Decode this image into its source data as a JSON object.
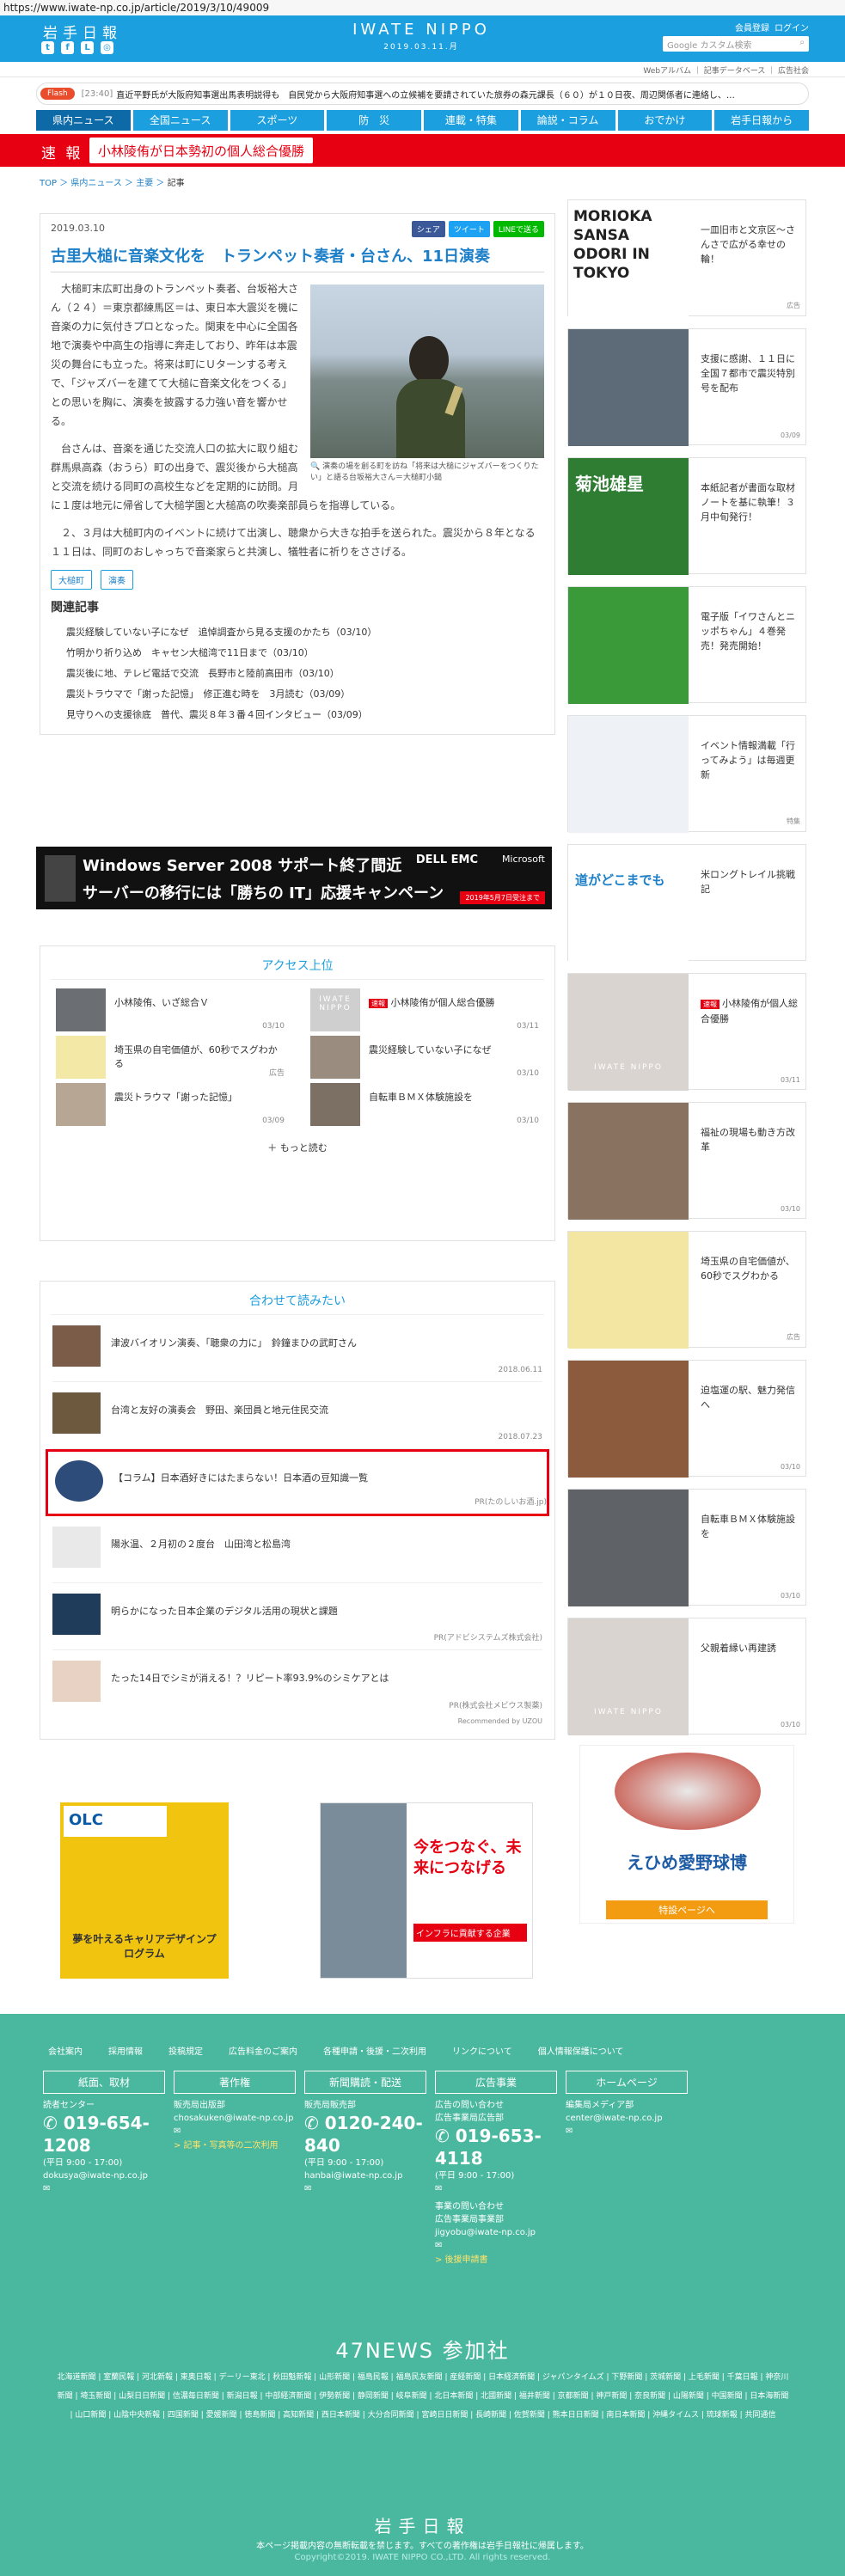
{
  "url": "https://www.iwate-np.co.jp/article/2019/3/10/49009",
  "header": {
    "logo": "岩手日報",
    "brand": "IWATE NIPPO",
    "date": "2019.03.11.月",
    "links": [
      "会員登録",
      "ログイン"
    ],
    "search_placeholder": "Google カスタム検索",
    "sub_links": [
      "Webアルバム",
      "記事データベース",
      "広告社会"
    ]
  },
  "flash": {
    "tag": "Flash",
    "time": "[23:40]",
    "text": "直近平野氏が大阪府知事選出馬表明説得も　自民党から大阪府知事選への立候補を要請されていた旅券の森元課長（６０）が１０日夜、周辺関係者に連絡し、…"
  },
  "nav": [
    "県内ニュース",
    "全国ニュース",
    "スポーツ",
    "防　災",
    "連載・特集",
    "論説・コラム",
    "おでかけ",
    "岩手日報から"
  ],
  "breaking": {
    "label": "速 報",
    "text": "小林陵侑が日本勢初の個人総合優勝"
  },
  "breadcrumb": [
    "TOP",
    "県内ニュース",
    "主要",
    "記事"
  ],
  "article": {
    "date": "2019.03.10",
    "share": [
      "シェア",
      "ツイート",
      "LINEで送る"
    ],
    "title": "古里大槌に音楽文化を　トランペット奏者・台さん、11日演奏",
    "caption": "演奏の場を創る町を訪ね「将来は大槌にジャズバーをつくりたい」と語る台坂裕大さん＝大槌町小鎚",
    "p1": "大槌町末広町出身のトランペット奏者、台坂裕大さん（２４）＝東京都練馬区＝は、東日本大震災を機に音楽の力に気付きプロとなった。関東を中心に全国各地で演奏や中高生の指導に奔走しており、昨年は本震災の舞台にも立った。将来は町にＵターンする考えで、「ジャズバーを建てて大槌に音楽文化をつくる」との思いを胸に、演奏を披露する力強い音を響かせる。",
    "p2": "台さんは、音楽を通じた交流人口の拡大に取り組む群馬県高森（おうら）町の出身で、震災後から大槌高と交流を続ける同町の高校生などを定期的に訪問。月に１度は地元に帰省して大槌学園と大槌高の吹奏楽部員らを指導している。",
    "p3": "２、３月は大槌町内のイベントに続けて出演し、聴衆から大きな拍手を送られた。震災から８年となる１１日は、同町のおしゃっちで音楽家らと共演し、犠牲者に祈りをささげる。",
    "tags": [
      "大槌町",
      "演奏"
    ],
    "related_heading": "関連記事",
    "related": [
      "震災経験していない子になぜ　追悼調査から見る支援のかたち（03/10）",
      "竹明かり祈り込め　キャセン大槌湾で11日まで（03/10）",
      "震災後に地、テレビ電話で交流　長野市と陸前高田市（03/10）",
      "震災トラウマで「謝った記憶」　修正進む時を　3月読む（03/09）",
      "見守りへの支援徐底　普代、震災８年３番４回インタビュー（03/09）"
    ]
  },
  "ad_banner": {
    "line1": "Windows Server 2008 サポート終了間近",
    "line2": "サーバーの移行には「勝ちの IT」応援キャンペーン",
    "vendor": "DELL EMC",
    "partner": "Microsoft",
    "small": "2019年5月7日受注まで"
  },
  "access": {
    "heading": "アクセス上位",
    "items": [
      {
        "title": "小林陵侑、いざ総合Ｖ",
        "date": "03/10"
      },
      {
        "title": "小林陵侑が個人総合優勝",
        "date": "03/11",
        "badge": "速報"
      },
      {
        "title": "埼玉県の自宅価値が、60秒でスグわかる",
        "date": "広告"
      },
      {
        "title": "震災経験していない子になぜ",
        "date": "03/10"
      },
      {
        "title": "震災トラウマ「謝った記憶」",
        "date": "03/09"
      },
      {
        "title": "自転車ＢＭＸ体験施設を",
        "date": "03/10"
      }
    ],
    "more": "もっと読む"
  },
  "recommend": {
    "heading": "合わせて読みたい",
    "items": [
      {
        "title": "津波バイオリン演奏、「聴衆の力に」　鈴鐘まひの武町さん",
        "date": "2018.06.11"
      },
      {
        "title": "台湾と友好の演奏会　野田、楽団員と地元住民交流",
        "date": "2018.07.23"
      },
      {
        "title": "【コラム】日本酒好きにはたまらない！日本酒の豆知識一覧",
        "date": "PR(たのしいお酒.jp)"
      },
      {
        "title": "陽氷温、２月初の２度台　山田湾と松島湾",
        "date": ""
      },
      {
        "title": "明らかになった日本企業のデジタル活用の現状と課題",
        "date": "PR(アドビシステムズ株式会社)"
      },
      {
        "title": "たった14日でシミが消える！？リピート率93.9%のシミケアとは",
        "date": "PR(株式会社メビウス製薬)"
      }
    ],
    "powered": "Recommended by UZOU"
  },
  "side": [
    {
      "title": "一皿旧市と文京区〜さんさで広がる幸せの輪！",
      "date": "広告",
      "thumb": "MORIOKA SANSA ODORI IN TOKYO"
    },
    {
      "title": "支援に感謝、１１日に全国７都市で震災特別号を配布",
      "date": "03/09"
    },
    {
      "title": "本紙記者が書面な取材ノートを基に執筆！３月中旬発行！",
      "date": "",
      "thumb": "菊池雄星"
    },
    {
      "title": "電子版「イワさんとニッポちゃん」４巻発売！発売開始！",
      "date": ""
    },
    {
      "title": "イベント情報満載「行ってみよう」は毎週更新",
      "date": "特集"
    },
    {
      "title": "米ロングトレイル挑戦記",
      "date": "",
      "thumb": "道がどこまでも"
    },
    {
      "title": "小林陵侑が個人総合優勝",
      "date": "03/11",
      "badge": "速報"
    },
    {
      "title": "福祉の現場も動き方改革",
      "date": "03/10"
    },
    {
      "title": "埼玉県の自宅価値が、60秒でスグわかる",
      "date": "広告"
    },
    {
      "title": "迫塩運の駅、魅力発信へ",
      "date": "03/10"
    },
    {
      "title": "自転車ＢＭＸ体験施設を",
      "date": "03/10"
    },
    {
      "title": "父親着縁い再建誘",
      "date": "03/10"
    }
  ],
  "bottom_ads": {
    "left": "夢を叶えるキャリアデザインプログラム",
    "mid": "今をつなぐ、未来につなげる",
    "mid_sub": "インフラに貢献する企業",
    "right": "えひめ愛野球博",
    "right_sub": "特設ページへ"
  },
  "footer": {
    "links": [
      "会社案内",
      "採用情報",
      "投稿規定",
      "広告料金のご案内",
      "各種申請・後援・二次利用",
      "リンクについて",
      "個人情報保護について"
    ],
    "cols": [
      {
        "head": "紙面、取材",
        "lines": [
          "読者センター"
        ],
        "phone": "019-654-1208",
        "hours": "(平日 9:00 - 17:00)",
        "mail": "dokusya@iwate-np.co.jp"
      },
      {
        "head": "著作権",
        "lines": [
          "販売局出版部"
        ],
        "mail": "chosakuken@iwate-np.co.jp",
        "link": "> 記事・写真等の二次利用"
      },
      {
        "head": "新聞購読・配送",
        "lines": [
          "販売局販売部"
        ],
        "phone": "0120-240-840",
        "hours": "(平日 9:00 - 17:00)",
        "mail": "hanbai@iwate-np.co.jp"
      },
      {
        "head": "広告事業",
        "lines": [
          "広告の問い合わせ",
          "広告事業局広告部"
        ],
        "phone": "019-653-4118",
        "hours": "(平日 9:00 - 17:00)",
        "lines2": [
          "事業の問い合わせ",
          "広告事業局事業部"
        ],
        "mail": "jigyobu@iwate-np.co.jp",
        "link": "> 後援申請書"
      },
      {
        "head": "ホームページ",
        "lines": [
          "編集局メディア部"
        ],
        "mail": "center@iwate-np.co.jp"
      }
    ],
    "news47": "47NEWS 参加社",
    "papers": "北海道新聞 | 室蘭民報 | 河北新報 | 東奥日報 | デーリー東北 | 秋田魁新報 | 山形新聞 | 福島民報 | 福島民友新聞 | 産経新聞 | 日本経済新聞 | ジャパンタイムズ | 下野新聞 | 茨城新聞 | 上毛新聞 | 千葉日報 | 神奈川新聞 | 埼玉新聞 | 山梨日日新聞 | 信濃毎日新聞 | 新潟日報 | 中部経済新聞 | 伊勢新聞 | 静岡新聞 | 岐阜新聞 | 北日本新聞 | 北國新聞 | 福井新聞 | 京都新聞 | 神戸新聞 | 奈良新聞 | 山陽新聞 | 中国新聞 | 日本海新聞 | 山口新聞 | 山陰中央新報 | 四国新聞 | 愛媛新聞 | 徳島新聞 | 高知新聞 | 西日本新聞 | 大分合同新聞 | 宮崎日日新聞 | 長崎新聞 | 佐賀新聞 | 熊本日日新聞 | 南日本新聞 | 沖縄タイムス | 琉球新報 | 共同通信",
    "brand": "岩手日報",
    "note": "本ページ掲載内容の無断転載を禁じます。すべての著作権は岩手日報社に帰属します。",
    "copyright": "Copyright©2019. IWATE NIPPO CO.,LTD. All rights reserved."
  }
}
